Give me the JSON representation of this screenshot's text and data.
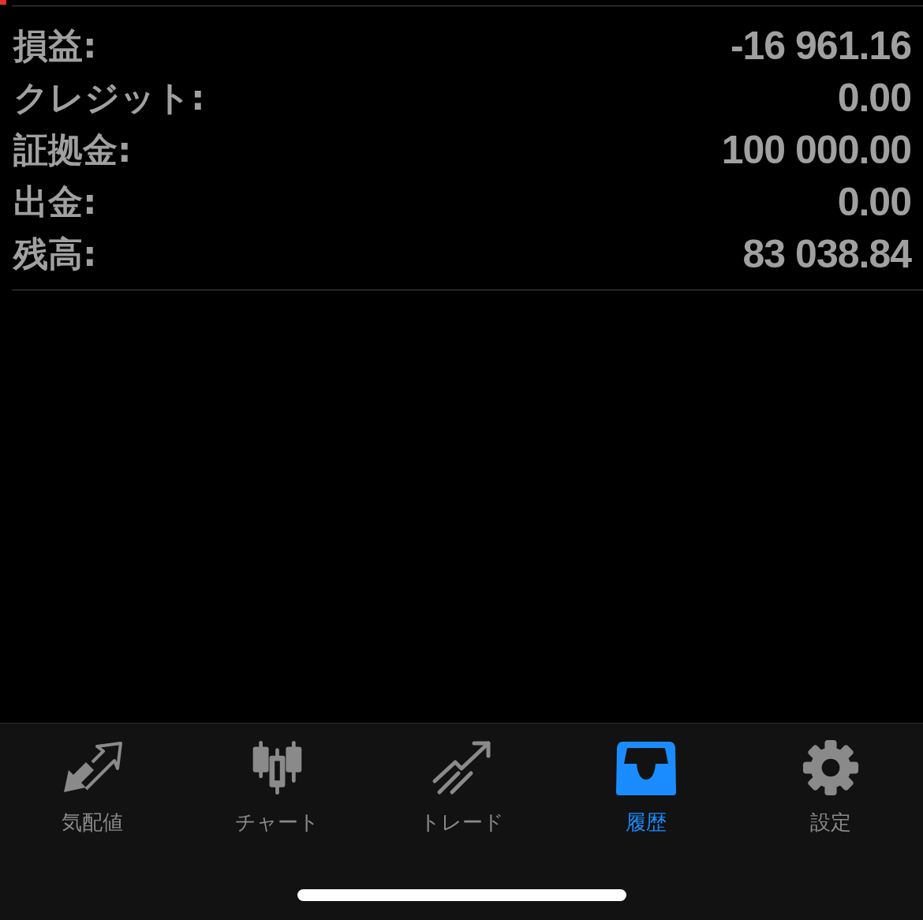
{
  "summary": [
    {
      "label": "損益:",
      "value": "-16 961.16"
    },
    {
      "label": "クレジット:",
      "value": "0.00"
    },
    {
      "label": "証拠金:",
      "value": "100 000.00"
    },
    {
      "label": "出金:",
      "value": "0.00"
    },
    {
      "label": "残高:",
      "value": "83 038.84"
    }
  ],
  "tabs": [
    {
      "label": "気配値",
      "selected": false
    },
    {
      "label": "チャート",
      "selected": false
    },
    {
      "label": "トレード",
      "selected": false
    },
    {
      "label": "履歴",
      "selected": true
    },
    {
      "label": "設定",
      "selected": false
    }
  ]
}
